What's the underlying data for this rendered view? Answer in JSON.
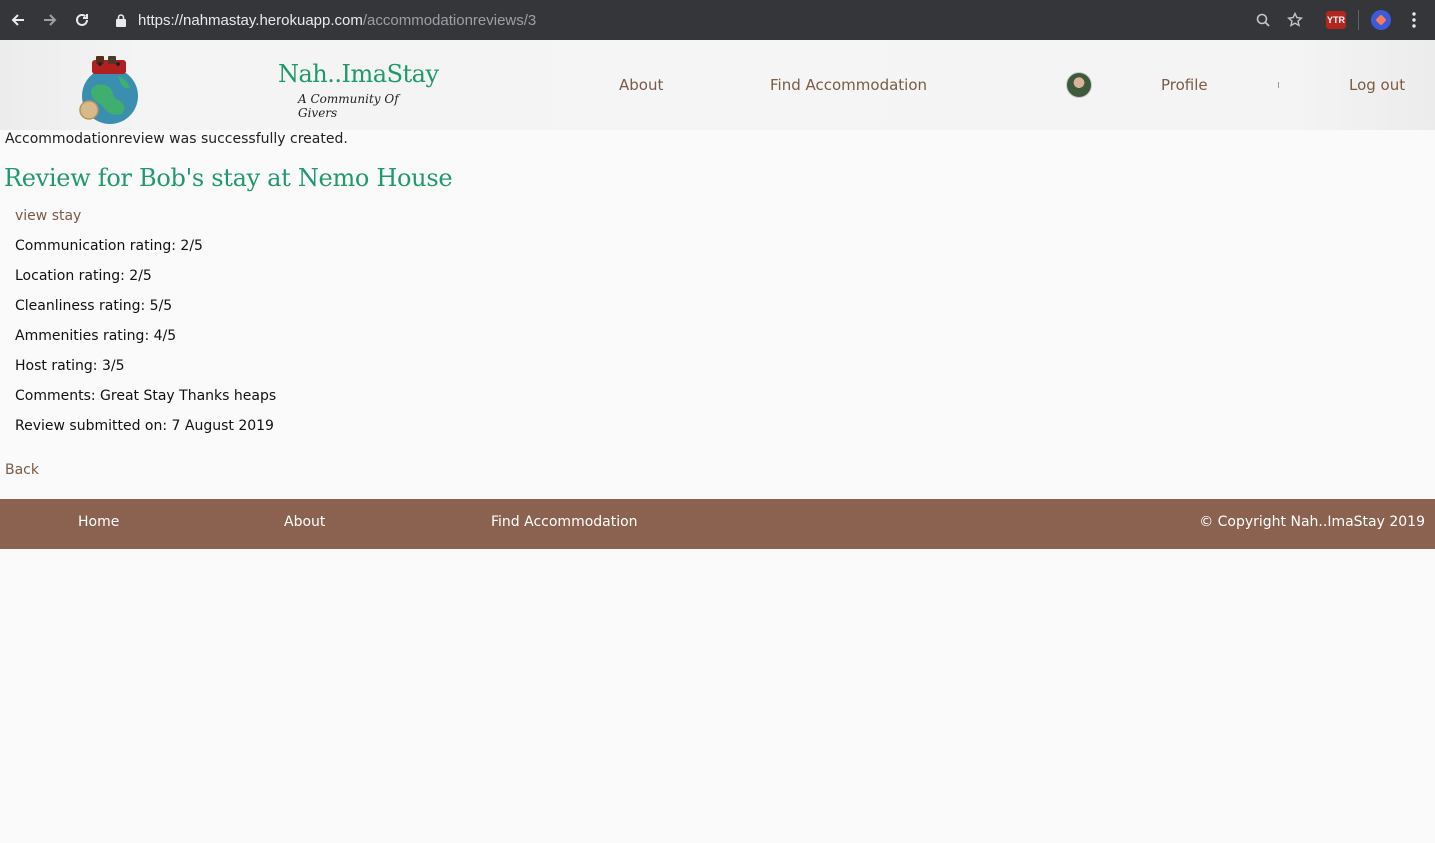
{
  "browser": {
    "url_host": "https://nahmastay.herokuapp.com",
    "url_path": "/accommodationreviews/3",
    "extension_label": "YTR"
  },
  "header": {
    "brand_title": "Nah..ImaStay",
    "brand_subtitle": "A Community Of Givers",
    "nav": {
      "about": "About",
      "find": "Find Accommodation",
      "profile": "Profile",
      "logout": "Log out"
    }
  },
  "main": {
    "notice": "Accommodationreview was successfully created.",
    "title": "Review for Bob's stay at Nemo House",
    "view_stay": "view stay",
    "details": [
      "Communication rating: 2/5",
      "Location rating: 2/5",
      "Cleanliness rating: 5/5",
      "Ammenities rating: 4/5",
      "Host rating: 3/5",
      "Comments: Great Stay Thanks heaps",
      "Review submitted on: 7 August 2019"
    ],
    "back": "Back"
  },
  "footer": {
    "home": "Home",
    "about": "About",
    "find": "Find Accommodation",
    "copyright": "© Copyright Nah..ImaStay 2019"
  },
  "colors": {
    "brand_green": "#1f9a6a",
    "link_brown": "#7b5a45",
    "footer_bg": "#8b614f"
  }
}
